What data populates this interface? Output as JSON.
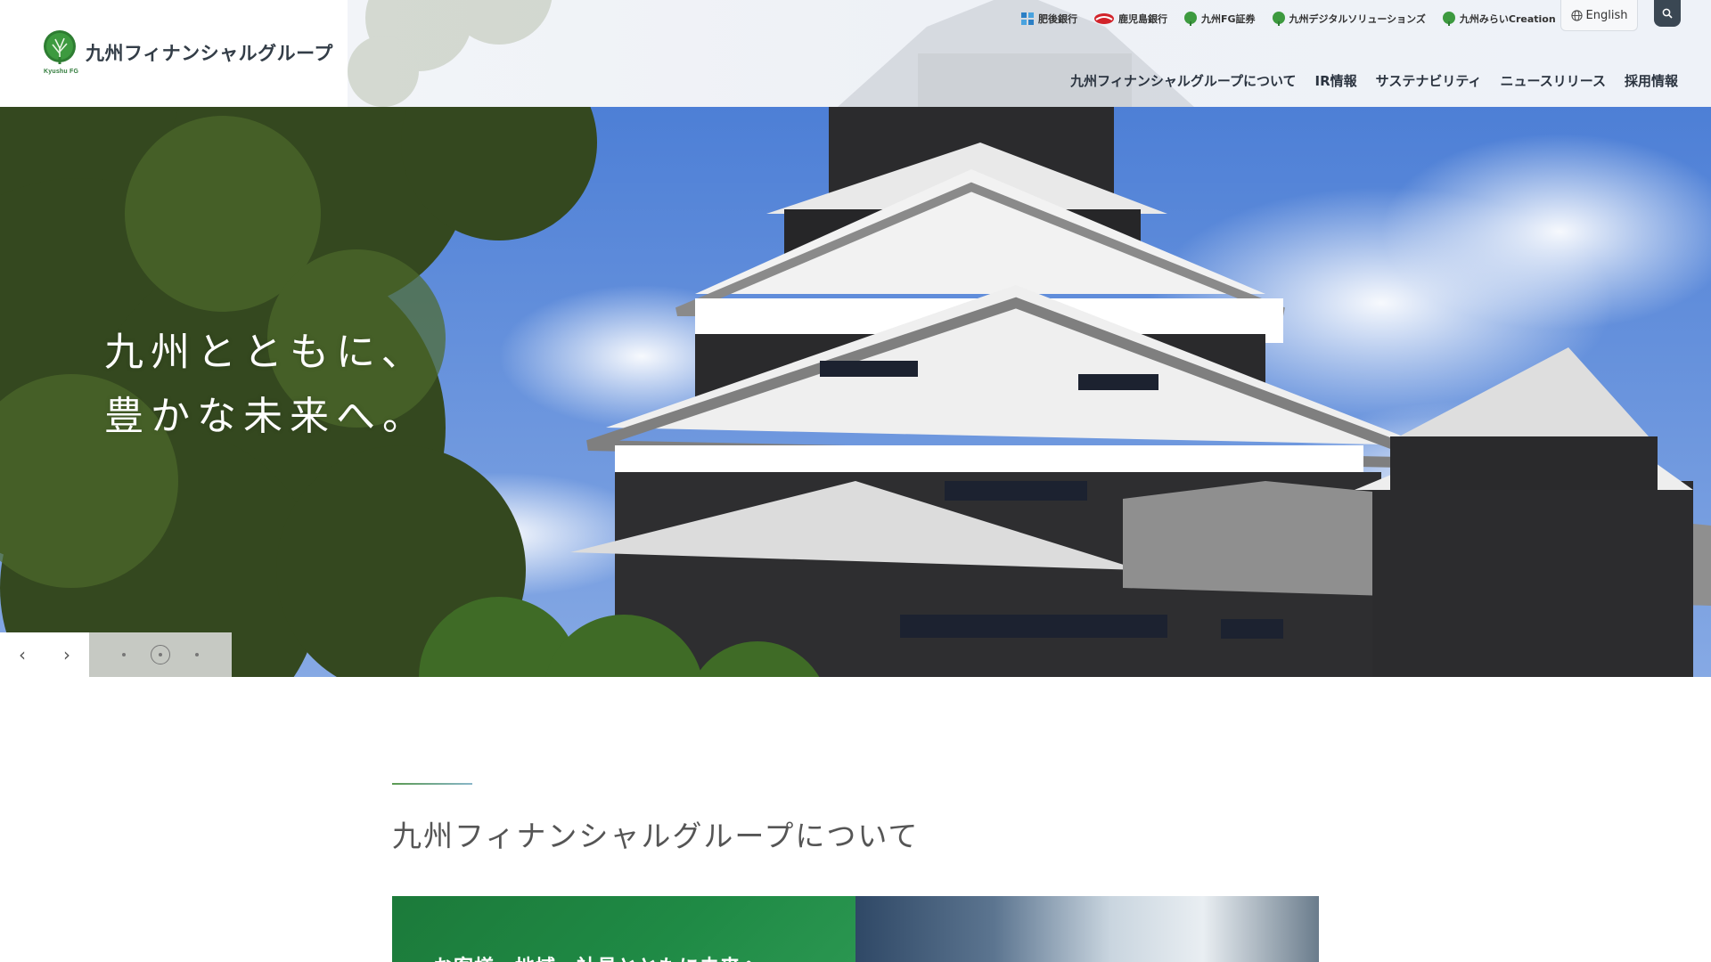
{
  "header": {
    "logo": {
      "name": "九州フィナンシャルグループ",
      "sub": "Kyushu FG"
    },
    "group_links": [
      {
        "label": "肥後銀行",
        "icon": "higo-bank-icon"
      },
      {
        "label": "鹿児島銀行",
        "icon": "kagoshima-bank-icon"
      },
      {
        "label": "九州FG証券",
        "icon": "kyushu-fg-tree-icon"
      },
      {
        "label": "九州デジタルソリューションズ",
        "icon": "kyushu-fg-tree-icon"
      },
      {
        "label": "九州みらいCreation",
        "icon": "kyushu-fg-tree-icon"
      }
    ],
    "language_button": "English",
    "nav": [
      "九州フィナンシャルグループについて",
      "IR情報",
      "サステナビリティ",
      "ニュースリリース",
      "採用情報"
    ]
  },
  "hero": {
    "copy_line1": "九州とともに、",
    "copy_line2": "豊かな未来へ。",
    "slider": {
      "prev": "‹",
      "next": "›",
      "slides": 3,
      "active_index": 1
    }
  },
  "about": {
    "title": "九州フィナンシャルグループについて",
    "card_text": "お客様・地域・社員とともに未来へ"
  },
  "colors": {
    "brand_green": "#1f8a45",
    "nav_text": "#2b3440",
    "search_button": "#3a4753",
    "sky": "#5a86d4"
  }
}
